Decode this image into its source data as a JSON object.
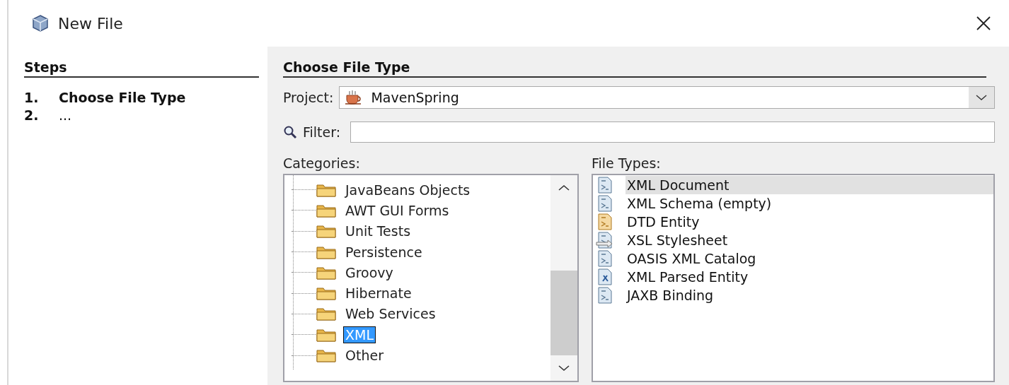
{
  "window": {
    "title": "New File"
  },
  "steps": {
    "title": "Steps",
    "items": [
      {
        "number": "1.",
        "label": "Choose File Type",
        "selected": true
      },
      {
        "number": "2.",
        "label": "...",
        "selected": false
      }
    ]
  },
  "panel": {
    "title": "Choose File Type",
    "project": {
      "label": "Project:",
      "value": "MavenSpring"
    },
    "filter": {
      "label": "Filter:"
    },
    "categories": {
      "label": "Categories:",
      "items": [
        {
          "label": "JavaBeans Objects",
          "selected": false
        },
        {
          "label": "AWT GUI Forms",
          "selected": false
        },
        {
          "label": "Unit Tests",
          "selected": false
        },
        {
          "label": "Persistence",
          "selected": false
        },
        {
          "label": "Groovy",
          "selected": false
        },
        {
          "label": "Hibernate",
          "selected": false
        },
        {
          "label": "Web Services",
          "selected": false
        },
        {
          "label": "XML",
          "selected": true
        },
        {
          "label": "Other",
          "selected": false
        }
      ]
    },
    "file_types": {
      "label": "File Types:",
      "items": [
        {
          "label": "XML Document",
          "kind": "xml",
          "selected": true
        },
        {
          "label": "XML Schema (empty)",
          "kind": "xml",
          "selected": false
        },
        {
          "label": "DTD Entity",
          "kind": "dtd",
          "selected": false
        },
        {
          "label": "XSL Stylesheet",
          "kind": "xsl",
          "selected": false
        },
        {
          "label": "OASIS XML Catalog",
          "kind": "xml",
          "selected": false
        },
        {
          "label": "XML Parsed Entity",
          "kind": "entity",
          "selected": false
        },
        {
          "label": "JAXB Binding",
          "kind": "xml",
          "selected": false
        }
      ]
    }
  }
}
